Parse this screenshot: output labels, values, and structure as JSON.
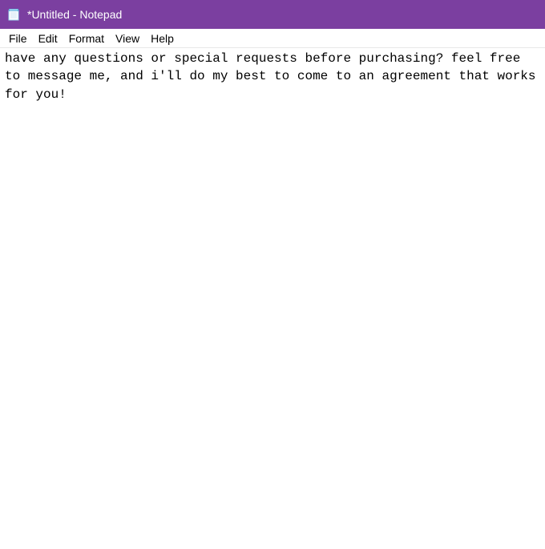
{
  "window": {
    "title": "*Untitled - Notepad"
  },
  "menubar": {
    "items": [
      "File",
      "Edit",
      "Format",
      "View",
      "Help"
    ]
  },
  "editor": {
    "content": "have any questions or special requests before purchasing? feel free to message me, and i'll do my best to come to an agreement that works for you!"
  }
}
